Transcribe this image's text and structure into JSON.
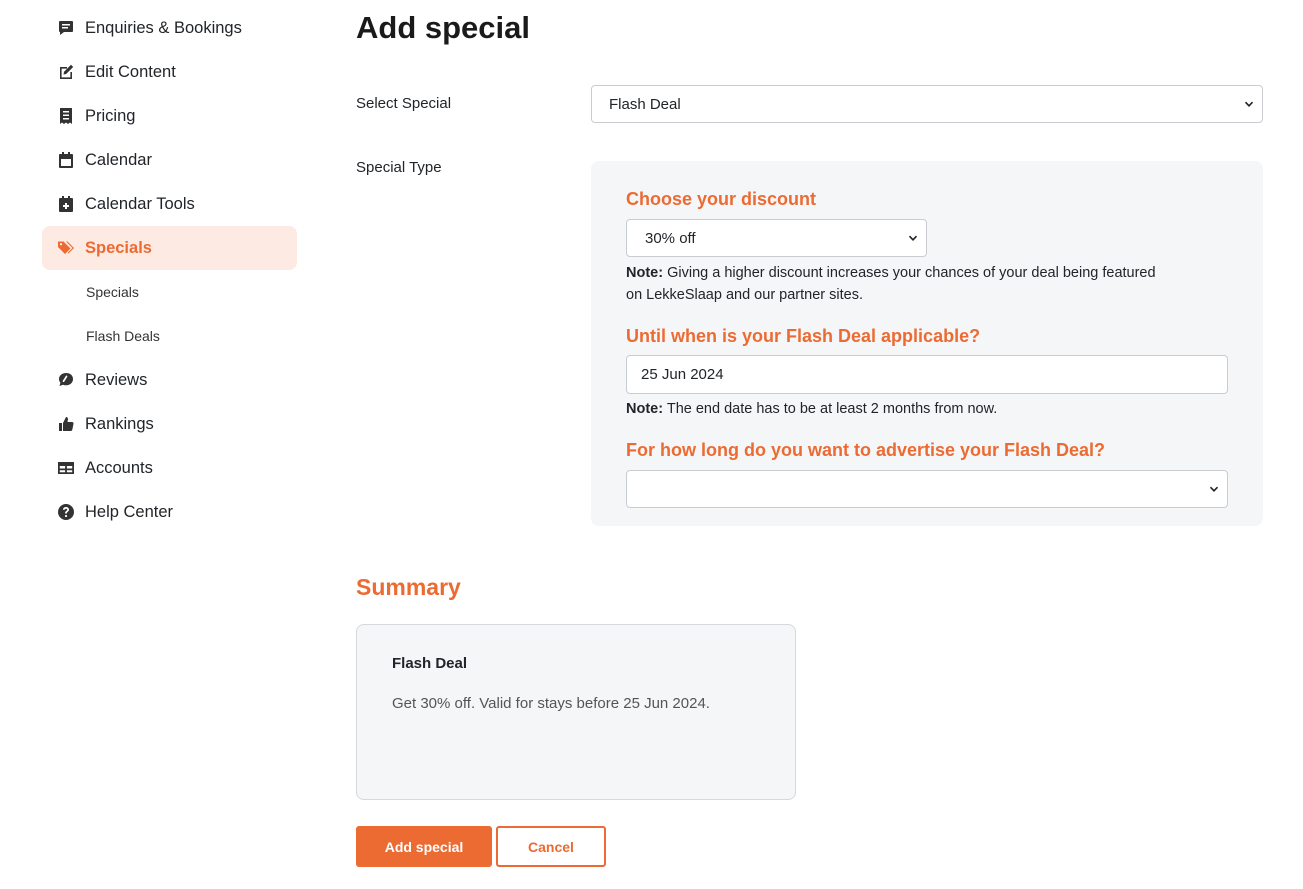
{
  "sidebar": {
    "items": [
      {
        "label": "Enquiries & Bookings",
        "icon": "message-icon"
      },
      {
        "label": "Edit Content",
        "icon": "edit-icon"
      },
      {
        "label": "Pricing",
        "icon": "receipt-icon"
      },
      {
        "label": "Calendar",
        "icon": "calendar-icon"
      },
      {
        "label": "Calendar Tools",
        "icon": "calendar-plus-icon"
      },
      {
        "label": "Specials",
        "icon": "tags-icon",
        "active": true
      },
      {
        "label": "Reviews",
        "icon": "comment-icon"
      },
      {
        "label": "Rankings",
        "icon": "thumbs-up-icon"
      },
      {
        "label": "Accounts",
        "icon": "table-icon"
      },
      {
        "label": "Help Center",
        "icon": "question-circle-icon"
      }
    ],
    "sub_items": [
      {
        "label": "Specials"
      },
      {
        "label": "Flash Deals"
      }
    ]
  },
  "page": {
    "title": "Add special"
  },
  "form": {
    "select_special_label": "Select Special",
    "select_special_value": "Flash Deal",
    "special_type_label": "Special Type",
    "discount_heading": "Choose your discount",
    "discount_value": "30% off",
    "discount_note_bold": "Note:",
    "discount_note_line1": "Giving a higher discount increases your chances of your deal being featured",
    "discount_note_line2": "on LekkeSlaap and our partner sites.",
    "until_heading": "Until when is your Flash Deal applicable?",
    "until_value": "25 Jun 2024",
    "until_note_bold": "Note:",
    "until_note": "The end date has to be at least 2 months from now.",
    "duration_heading": "For how long do you want to advertise your Flash Deal?",
    "duration_value": ""
  },
  "summary": {
    "title": "Summary",
    "card_name": "Flash Deal",
    "card_description": "Get 30% off. Valid for stays before 25 Jun 2024."
  },
  "actions": {
    "add_label": "Add special",
    "cancel_label": "Cancel"
  },
  "colors": {
    "accent": "#ec6b32",
    "active_bg": "#fdeae3",
    "panel_bg": "#f5f6f8"
  }
}
